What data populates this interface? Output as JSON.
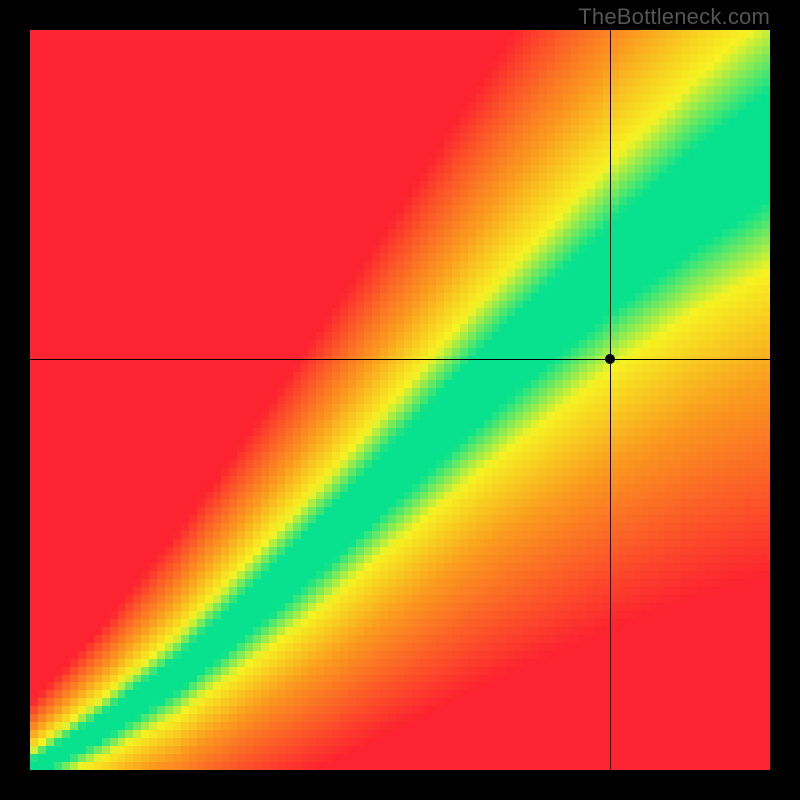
{
  "watermark": "TheBottleneck.com",
  "chart_data": {
    "type": "heatmap",
    "title": "",
    "xlabel": "",
    "ylabel": "",
    "xlim": [
      0,
      1
    ],
    "ylim": [
      0,
      1
    ],
    "grid": false,
    "legend": false,
    "description": "Bottleneck heatmap: green along a curved diagonal (balanced), transitioning through yellow/orange to red away from the diagonal. A crosshair marks a specific (CPU, GPU) point.",
    "marker": {
      "x": 0.785,
      "y": 0.555
    },
    "crosshair": {
      "x": 0.785,
      "y": 0.555
    },
    "ridge": {
      "comment": "Approximate centerline of the green optimal band as (x, y) pairs in [0,1].",
      "points": [
        [
          0.0,
          0.0
        ],
        [
          0.1,
          0.06
        ],
        [
          0.2,
          0.13
        ],
        [
          0.3,
          0.22
        ],
        [
          0.4,
          0.31
        ],
        [
          0.5,
          0.41
        ],
        [
          0.6,
          0.51
        ],
        [
          0.7,
          0.6
        ],
        [
          0.8,
          0.69
        ],
        [
          0.9,
          0.77
        ],
        [
          1.0,
          0.84
        ]
      ]
    },
    "color_stops": {
      "green": "#08e28f",
      "yellow": "#f7f323",
      "orange": "#fb9a1f",
      "red": "#fd2330"
    }
  }
}
